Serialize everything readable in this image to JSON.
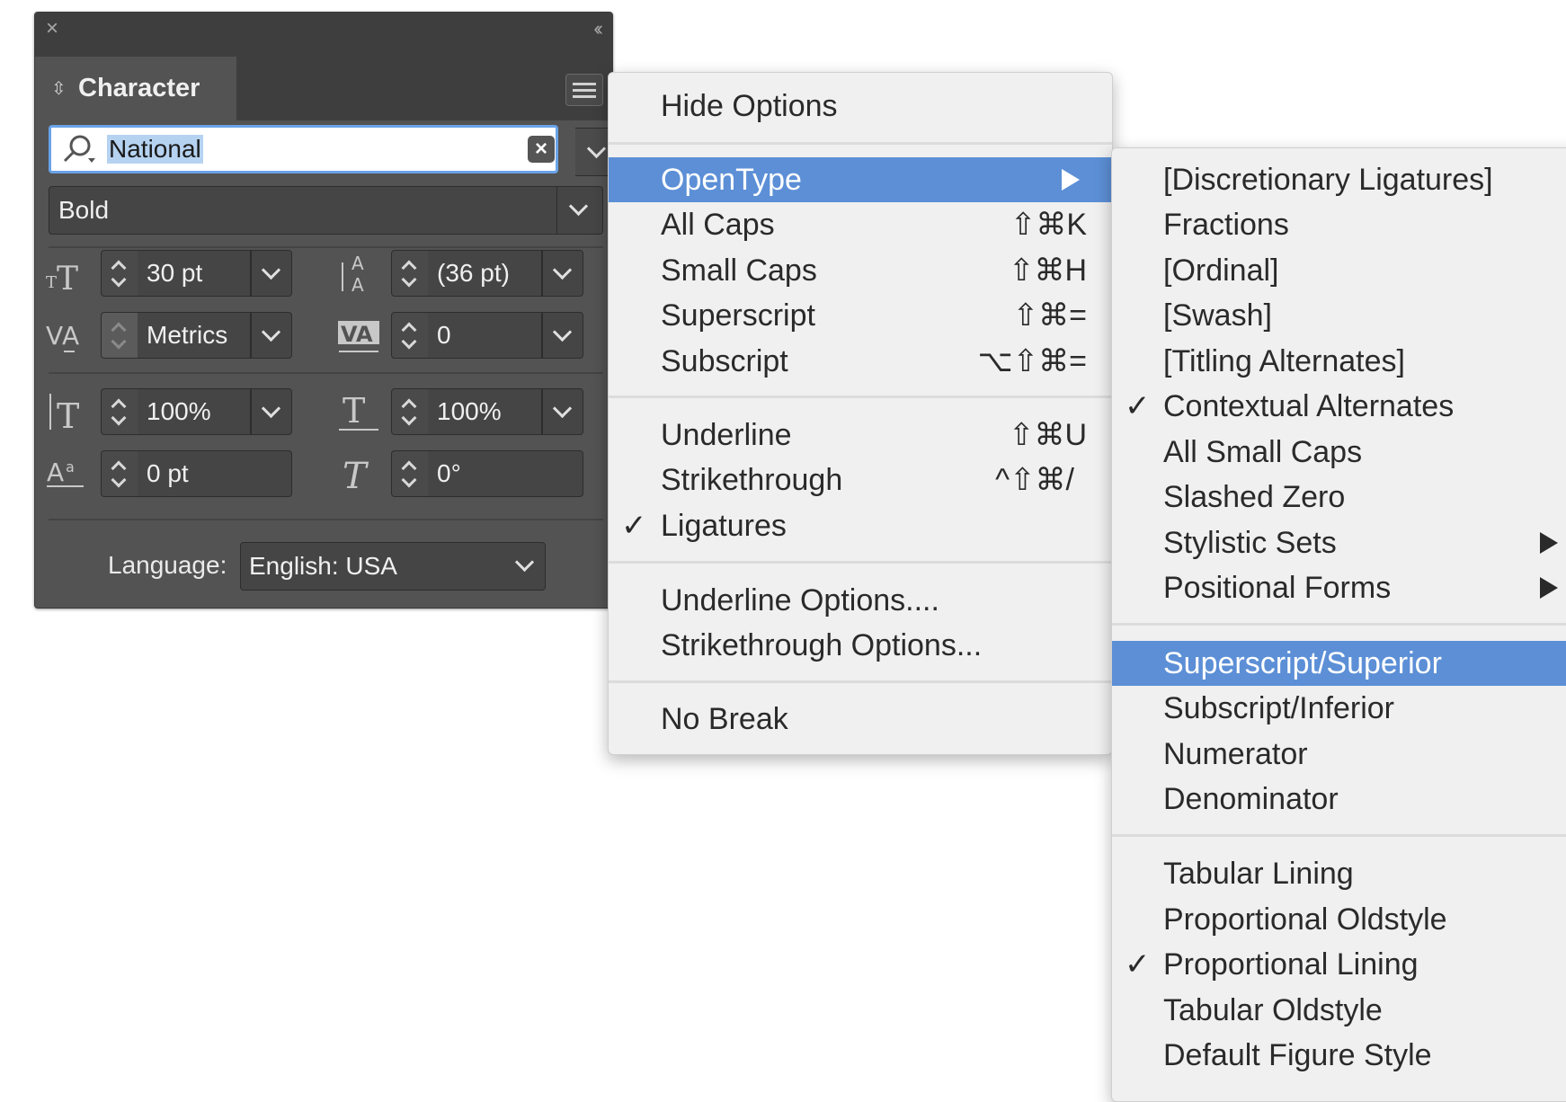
{
  "panel": {
    "close_icon": "×",
    "collapse_icon": "‹‹",
    "tab_label": "Character",
    "font_name": "National",
    "font_style": "Bold",
    "size": "30 pt",
    "leading": "(36 pt)",
    "kerning": "Metrics",
    "tracking": "0",
    "vertical_scale": "100%",
    "horizontal_scale": "100%",
    "baseline_shift": "0 pt",
    "skew": "0°",
    "language_label": "Language:",
    "language_value": "English: USA"
  },
  "menu": {
    "items": [
      {
        "label": "Hide Options",
        "shortcut": ""
      },
      {
        "label": "OpenType",
        "shortcut": "",
        "submenu": true,
        "selected": true
      },
      {
        "label": "All Caps",
        "shortcut": "⇧⌘K"
      },
      {
        "label": "Small Caps",
        "shortcut": "⇧⌘H"
      },
      {
        "label": "Superscript",
        "shortcut": "⇧⌘="
      },
      {
        "label": "Subscript",
        "shortcut": "⌥⇧⌘="
      },
      {
        "label": "Underline",
        "shortcut": "⇧⌘U"
      },
      {
        "label": "Strikethrough",
        "shortcut": "^⇧⌘/"
      },
      {
        "label": "Ligatures",
        "shortcut": "",
        "checked": true
      },
      {
        "label": "Underline Options....",
        "shortcut": ""
      },
      {
        "label": "Strikethrough Options...",
        "shortcut": ""
      },
      {
        "label": "No Break",
        "shortcut": ""
      }
    ]
  },
  "submenu": {
    "items": [
      {
        "label": "[Discretionary Ligatures]"
      },
      {
        "label": "Fractions"
      },
      {
        "label": "[Ordinal]"
      },
      {
        "label": "[Swash]"
      },
      {
        "label": "[Titling Alternates]"
      },
      {
        "label": "Contextual Alternates",
        "checked": true
      },
      {
        "label": "All Small Caps"
      },
      {
        "label": "Slashed Zero"
      },
      {
        "label": "Stylistic Sets",
        "submenu": true
      },
      {
        "label": "Positional Forms",
        "submenu": true
      },
      {
        "label": "Superscript/Superior",
        "selected": true
      },
      {
        "label": "Subscript/Inferior"
      },
      {
        "label": "Numerator"
      },
      {
        "label": "Denominator"
      },
      {
        "label": "Tabular Lining"
      },
      {
        "label": "Proportional Oldstyle"
      },
      {
        "label": "Proportional Lining",
        "checked": true
      },
      {
        "label": "Tabular Oldstyle"
      },
      {
        "label": "Default Figure Style"
      }
    ]
  },
  "check_glyph": "✓",
  "colors": {
    "panel_bg": "#535353",
    "menu_bg": "#f0f0f0",
    "highlight": "#5c8fd6",
    "search_border": "#6aa3e8"
  }
}
